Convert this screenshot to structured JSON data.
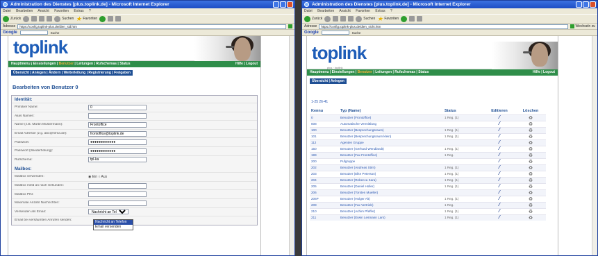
{
  "left": {
    "title": "Administration des Dienstes [plus.toplink.de] - Microsoft Internet Explorer",
    "menu": [
      "Datei",
      "Bearbeiten",
      "Ansicht",
      "Favoriten",
      "Extras",
      "?"
    ],
    "toolbar": {
      "back": "Zurück",
      "search": "Suchen",
      "favorites": "Favoriten"
    },
    "address": {
      "label": "Adresse",
      "value": "https://config.toplink-plus.de/dien_sid.htm"
    },
    "google": {
      "logo": "Google",
      "search": "Suche"
    },
    "logo": "toplink",
    "logo_tag": "plus · toplink",
    "nav_green": {
      "links": "Hauptmenu | Einstellungen | ",
      "current": "Benutzer",
      "rest": " | Leitungen | Rufschemas | Status",
      "right": "Hilfe | Logout"
    },
    "nav_blue": "Übersicht | Anlegen | Ändern | Weiterleitung | Registrierung | Freigaben",
    "page_title": "Bearbeiten von Benutzer 0",
    "sections": {
      "identity": "Identität:",
      "mailbox": "Mailbox:"
    },
    "identity_rows": [
      {
        "label": "Primärer Name:",
        "value": "0"
      },
      {
        "label": "Alias Namen:",
        "value": ""
      },
      {
        "label": "Name (z.B. Martin Mustermann):",
        "value": "Frontoffice"
      },
      {
        "label": "Email Adresse (z.g. abc@firma.de):",
        "value": "frontoffice@toplink.de"
      },
      {
        "label": "Passwort:",
        "value": "●●●●●●●●●●●●"
      },
      {
        "label": "Passwort (Wiederholung):",
        "value": "●●●●●●●●●●●●"
      },
      {
        "label": "Rufschema:",
        "value": "tpl-ka"
      }
    ],
    "mailbox_rows": [
      {
        "label": "Mailbox verwenden:",
        "value": "◉ Ein ○ Aus"
      },
      {
        "label": "Mailbox meld an nach Sekunden:",
        "value": ""
      },
      {
        "label": "Mailbox PIN:",
        "value": ""
      },
      {
        "label": "Maximale Anzahl Nachrichten:",
        "value": ""
      },
      {
        "label": "Versenden als Email:",
        "value": "Nachricht an Telefon"
      },
      {
        "label": "Email bei versäumten Anrufen senden:",
        "value": ""
      }
    ],
    "dropdown_options": [
      "Nachricht an Telefon",
      "Email versenden"
    ]
  },
  "right": {
    "title": "Administration des Dienstes [plus.toplink.de] - Microsoft Internet Explorer",
    "menu": [
      "Datei",
      "Bearbeiten",
      "Ansicht",
      "Favoriten",
      "Extras",
      "?"
    ],
    "toolbar": {
      "back": "Zurück",
      "search": "Suchen",
      "favorites": "Favoriten"
    },
    "address": {
      "label": "Adresse",
      "value": "https://config.toplink-plus.de/dien_sicht.htm"
    },
    "go": "Wechseln zu",
    "google": {
      "logo": "Google",
      "search": "Suche"
    },
    "logo": "toplink",
    "logo_tag": "plus · toplink",
    "nav_green": {
      "links": "Hauptmenu | Einstellungen | ",
      "current": "Benutzer",
      "rest": " | Leitungen | Rufschemas | Status",
      "right": "Hilfe | Logout"
    },
    "nav_blue": "Übersicht | Anlegen",
    "range": "1-25 26-41",
    "headers": {
      "kennung": "Kennu",
      "typ": "Typ (Name)",
      "status": "Status",
      "edit": "Editieren",
      "delete": "Löschen"
    },
    "rows": [
      {
        "id": "0",
        "type": "Benutzer (Frontoffice)",
        "status": "1 Reg. (1)"
      },
      {
        "id": "008",
        "type": "Automatische Vermittlung",
        "status": ""
      },
      {
        "id": "100",
        "type": "Benutzer (Besprechungsraum)",
        "status": "1 Reg. (1)"
      },
      {
        "id": "101",
        "type": "Benutzer (Besprechungsraum klein)",
        "status": "1 Reg. (1)"
      },
      {
        "id": "112",
        "type": "Agenten Gruppe",
        "status": ""
      },
      {
        "id": "150",
        "type": "Benutzer (Gerhard Wendlandt)",
        "status": "1 Reg. (1)"
      },
      {
        "id": "199",
        "type": "Benutzer (Fax Frontoffice)",
        "status": "1 Reg."
      },
      {
        "id": "200",
        "type": "Pufgruppe",
        "status": ""
      },
      {
        "id": "202",
        "type": "Benutzer (Andreas Stirn)",
        "status": "1 Reg. (1)"
      },
      {
        "id": "203",
        "type": "Benutzer (Elke Peterson)",
        "status": "1 Reg. (1)"
      },
      {
        "id": "204",
        "type": "Benutzer (Rebecca Kara)",
        "status": "1 Reg. (1)"
      },
      {
        "id": "205",
        "type": "Benutzer (Daniel Holler)",
        "status": "1 Reg. (1)"
      },
      {
        "id": "206",
        "type": "Benutzer (Torsten Mueller)",
        "status": ""
      },
      {
        "id": "206P",
        "type": "Benutzer (Holger Alt)",
        "status": "1 Reg. (1)"
      },
      {
        "id": "209",
        "type": "Benutzer (Fax Vertrieb)",
        "status": "1 Reg."
      },
      {
        "id": "210",
        "type": "Benutzer (Achim Pfeffer)",
        "status": "1 Reg. (1)"
      },
      {
        "id": "211",
        "type": "Benutzer (Erwin Lesmann Lars)",
        "status": "1 Reg. (1)"
      }
    ]
  }
}
